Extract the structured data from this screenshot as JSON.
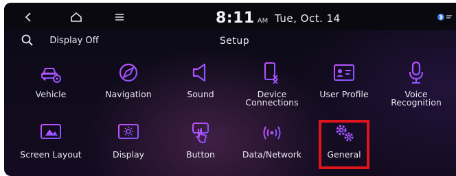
{
  "status_bar": {
    "time": "8:11",
    "ampm": "AM",
    "date": "Tue, Oct. 14"
  },
  "title_bar": {
    "display_off_label": "Display Off",
    "title": "Setup"
  },
  "menu_items": [
    {
      "label": "Vehicle",
      "icon": "vehicle-settings-icon"
    },
    {
      "label": "Navigation",
      "icon": "navigation-icon"
    },
    {
      "label": "Sound",
      "icon": "speaker-icon"
    },
    {
      "label_line1": "Device",
      "label_line2": "Connections",
      "icon": "device-connections-icon"
    },
    {
      "label": "User Profile",
      "icon": "user-profile-icon"
    },
    {
      "label_line1": "Voice",
      "label_line2": "Recognition",
      "icon": "microphone-icon"
    },
    {
      "label": "Screen Layout",
      "icon": "screen-layout-icon"
    },
    {
      "label": "Display",
      "icon": "display-icon"
    },
    {
      "label": "Button",
      "icon": "button-icon"
    },
    {
      "label": "Data/Network",
      "icon": "data-network-icon"
    },
    {
      "label": "General",
      "icon": "gear-icon",
      "highlighted": true
    }
  ],
  "colors": {
    "icon_gradient_start": "#c64bff",
    "icon_gradient_end": "#7a4dff",
    "highlight": "#e0151c"
  }
}
